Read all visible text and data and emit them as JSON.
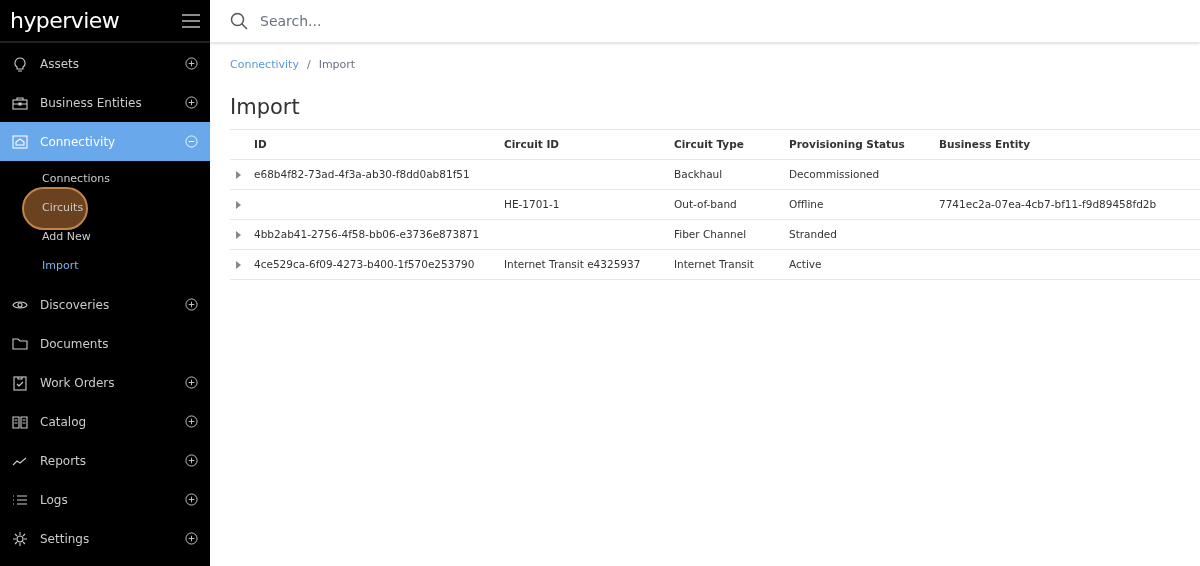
{
  "brand": "hyperview",
  "search": {
    "placeholder": "Search..."
  },
  "sidebar": {
    "items": [
      {
        "label": "Assets",
        "expanded": false,
        "selected": false
      },
      {
        "label": "Business Entities",
        "expanded": false,
        "selected": false
      },
      {
        "label": "Connectivity",
        "expanded": true,
        "selected": true,
        "children": [
          {
            "label": "Connections",
            "selected": false,
            "highlighted": false
          },
          {
            "label": "Circuits",
            "selected": false,
            "highlighted": true
          },
          {
            "label": "Add New",
            "selected": false,
            "highlighted": false
          },
          {
            "label": "Import",
            "selected": true,
            "highlighted": false
          }
        ]
      },
      {
        "label": "Discoveries",
        "expanded": false,
        "selected": false
      },
      {
        "label": "Documents",
        "selected": false
      },
      {
        "label": "Work Orders",
        "expanded": false,
        "selected": false
      },
      {
        "label": "Catalog",
        "expanded": false,
        "selected": false
      },
      {
        "label": "Reports",
        "expanded": false,
        "selected": false
      },
      {
        "label": "Logs",
        "expanded": false,
        "selected": false
      },
      {
        "label": "Settings",
        "expanded": false,
        "selected": false
      }
    ]
  },
  "breadcrumb": {
    "items": [
      "Connectivity",
      "Import"
    ],
    "separator": "/"
  },
  "title": "Import",
  "table": {
    "columns": [
      "ID",
      "Circuit ID",
      "Circuit Type",
      "Provisioning Status",
      "Business Entity"
    ],
    "rows": [
      [
        "e68b4f82-73ad-4f3a-ab30-f8dd0ab81f51",
        "",
        "Backhaul",
        "Decommissioned",
        ""
      ],
      [
        "",
        "HE-1701-1",
        "Out-of-band",
        "Offline",
        "7741ec2a-07ea-4cb7-bf11-f9d89458fd2b"
      ],
      [
        "4bb2ab41-2756-4f58-bb06-e3736e873871",
        "",
        "Fiber Channel",
        "Stranded",
        ""
      ],
      [
        "4ce529ca-6f09-4273-b400-1f570e253790",
        "Internet Transit e4325937",
        "Internet Transit",
        "Active",
        ""
      ]
    ]
  }
}
